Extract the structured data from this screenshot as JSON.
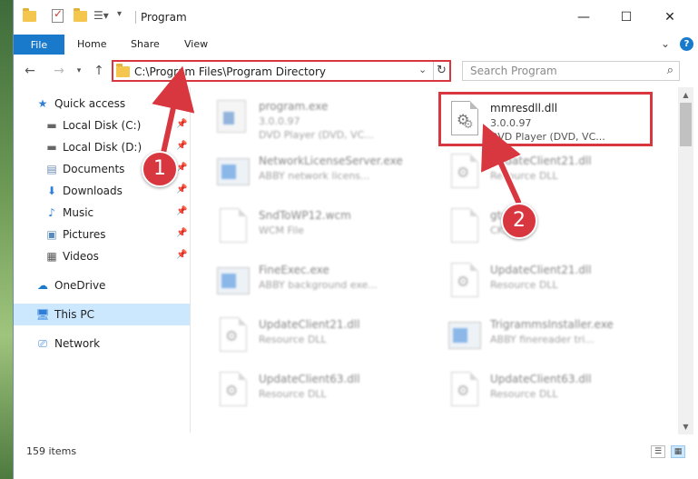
{
  "window": {
    "title": "Program",
    "controls": {
      "minimize": "—",
      "maximize": "☐",
      "close": "✕"
    }
  },
  "ribbon": {
    "file": "File",
    "tabs": [
      "Home",
      "Share",
      "View"
    ],
    "expand_icon": "chevron-down-icon",
    "help_icon": "?"
  },
  "address": {
    "path": "C:\\Program Files\\Program Directory",
    "search_placeholder": "Search Program"
  },
  "sidebar": {
    "items": [
      {
        "label": "Quick access",
        "icon": "star-icon",
        "pinned": false
      },
      {
        "label": "Local Disk (C:)",
        "icon": "drive-icon",
        "pinned": true
      },
      {
        "label": "Local Disk (D:)",
        "icon": "drive-icon",
        "pinned": true
      },
      {
        "label": "Documents",
        "icon": "documents-icon",
        "pinned": true
      },
      {
        "label": "Downloads",
        "icon": "downloads-icon",
        "pinned": true
      },
      {
        "label": "Music",
        "icon": "music-icon",
        "pinned": true
      },
      {
        "label": "Pictures",
        "icon": "pictures-icon",
        "pinned": true
      },
      {
        "label": "Videos",
        "icon": "videos-icon",
        "pinned": true
      },
      {
        "label": "OneDrive",
        "icon": "cloud-icon",
        "pinned": false
      },
      {
        "label": "This PC",
        "icon": "computer-icon",
        "pinned": false,
        "selected": true
      },
      {
        "label": "Network",
        "icon": "network-icon",
        "pinned": false
      }
    ]
  },
  "files": [
    {
      "name": "program.exe",
      "line1": "3.0.0.97",
      "line2": "DVD Player (DVD, VC...",
      "icon": "exe-icon"
    },
    {
      "name": "mmresdll.dll",
      "line1": "3.0.0.97",
      "line2": "DVD Player (DVD, VC...",
      "icon": "dll-icon",
      "highlighted": true
    },
    {
      "name": "NetworkLicenseServer.exe",
      "line1": "ABBY network licens...",
      "line2": "",
      "icon": "app-icon"
    },
    {
      "name": "UpdateClient21.dll",
      "line1": "Resource DLL",
      "line2": "",
      "icon": "dll-icon"
    },
    {
      "name": "SndToWP12.wcm",
      "line1": "WCM File",
      "line2": "",
      "icon": "doc-icon"
    },
    {
      "name": "gtd.dll",
      "line1": "CK...",
      "line2": "",
      "icon": "doc-icon"
    },
    {
      "name": "FineExec.exe",
      "line1": "ABBY background exe...",
      "line2": "",
      "icon": "app-icon"
    },
    {
      "name": "UpdateClient21.dll",
      "line1": "Resource DLL",
      "line2": "",
      "icon": "dll-icon"
    },
    {
      "name": "UpdateClient21.dll",
      "line1": "Resource DLL",
      "line2": "",
      "icon": "dll-icon"
    },
    {
      "name": "TrigrammsInstaller.exe",
      "line1": "ABBY finereader tri...",
      "line2": "",
      "icon": "app-icon"
    },
    {
      "name": "UpdateClient63.dll",
      "line1": "Resource DLL",
      "line2": "",
      "icon": "dll-icon"
    },
    {
      "name": "UpdateClient63.dll",
      "line1": "Resource DLL",
      "line2": "",
      "icon": "dll-icon"
    }
  ],
  "status": {
    "count": "159 items"
  },
  "callouts": {
    "one": "1",
    "two": "2"
  },
  "colors": {
    "accent": "#1979ca",
    "highlight": "#d9373f",
    "selected": "#cce8ff"
  }
}
